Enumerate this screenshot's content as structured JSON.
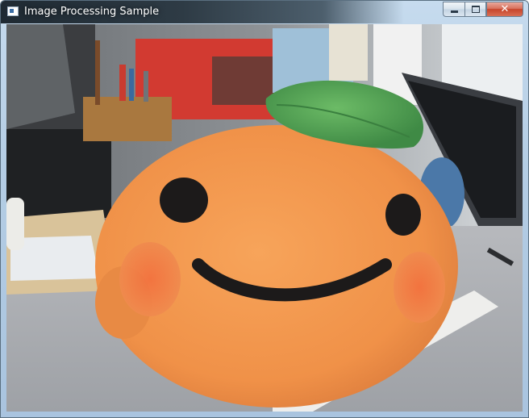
{
  "window": {
    "title": "Image Processing Sample",
    "buttons": {
      "minimize": "minimize",
      "maximize": "maximize",
      "close": "✕"
    }
  },
  "colors": {
    "orange_body": "#f39a4c",
    "leaf_green": "#5aa65a",
    "face_features": "#1c1a1a",
    "cheeks": "#f27a48"
  },
  "icons": [
    "app-window-icon",
    "minimize-icon",
    "maximize-icon",
    "close-icon"
  ]
}
